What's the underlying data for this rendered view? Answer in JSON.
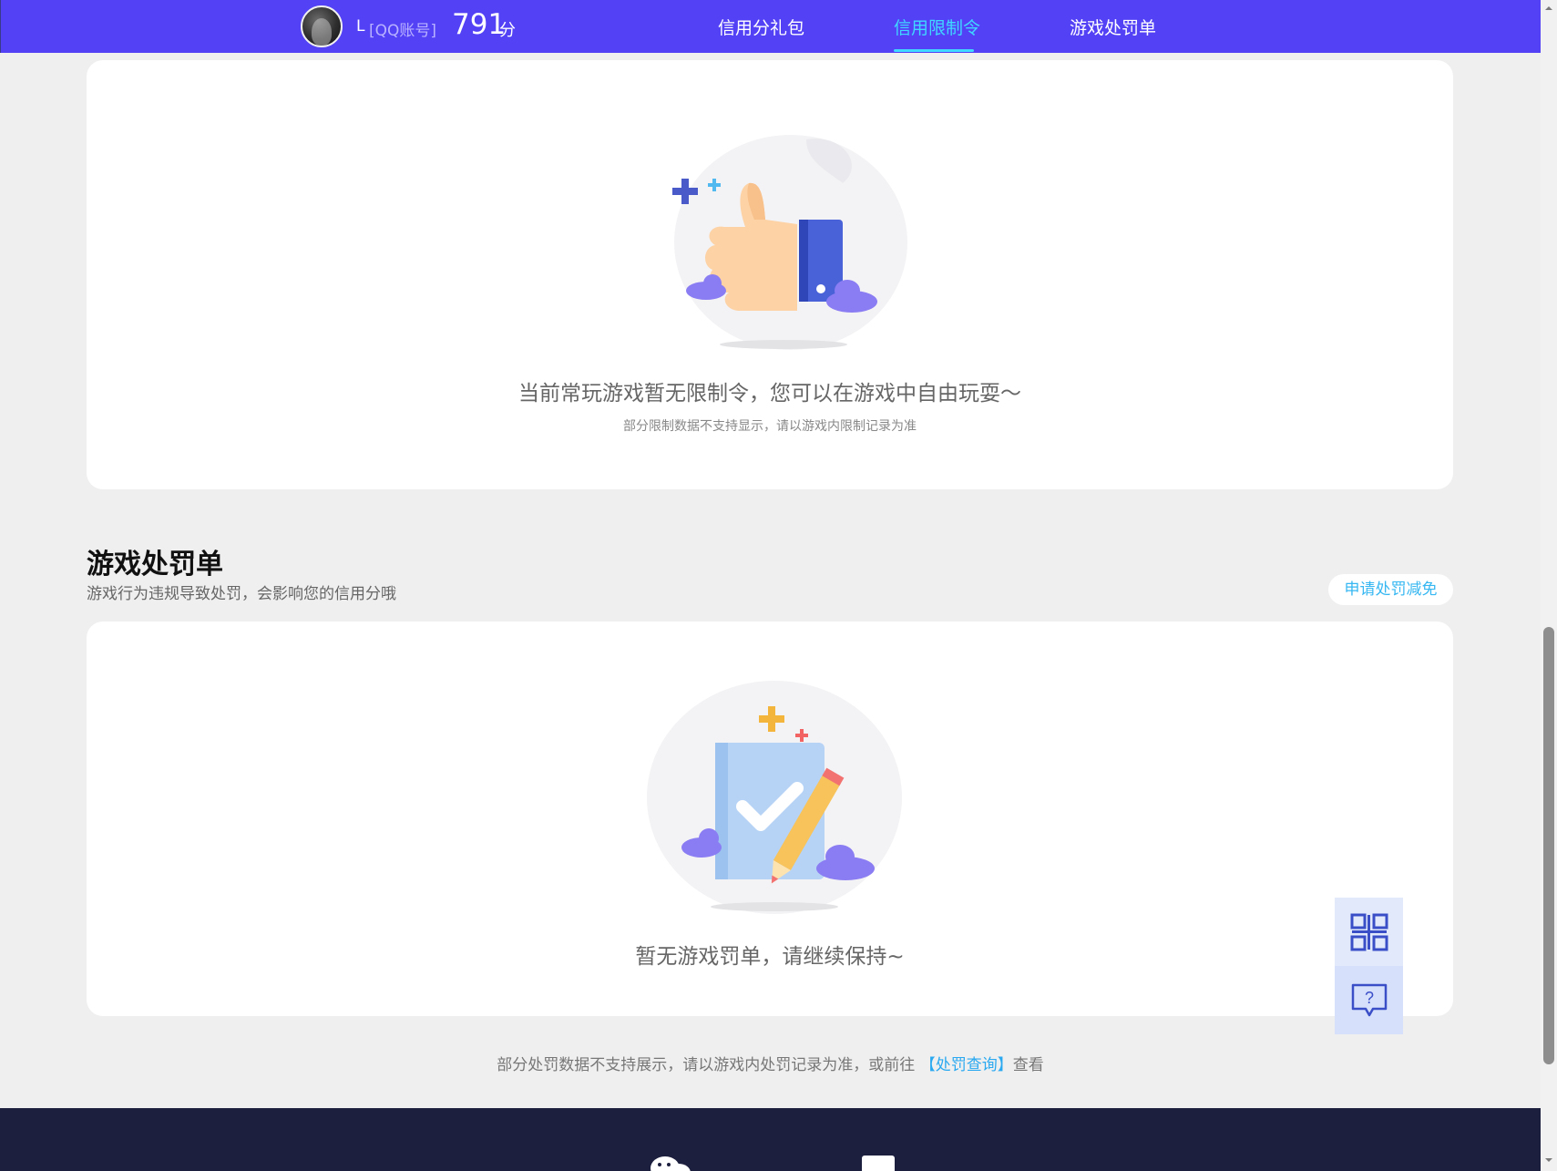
{
  "header": {
    "user_name": "L",
    "account_type": "[QQ账号]",
    "score": "791",
    "score_unit": "分",
    "tabs": [
      {
        "label": "信用分礼包"
      },
      {
        "label": "信用限制令"
      },
      {
        "label": "游戏处罚单"
      }
    ],
    "active_tab": "信用限制令"
  },
  "restriction_card": {
    "empty_title": "当前常玩游戏暂无限制令，您可以在游戏中自由玩耍～",
    "empty_note": "部分限制数据不支持显示，请以游戏内限制记录为准"
  },
  "penalty_section": {
    "title": "游戏处罚单",
    "description": "游戏行为违规导致处罚，会影响您的信用分哦",
    "appeal_button": "申请处罚减免",
    "empty_title": "暂无游戏罚单，请继续保持~"
  },
  "footer_note": {
    "prefix": "部分处罚数据不支持展示，请以游戏内处罚记录为准，或前往",
    "link": "【处罚查询】",
    "suffix": "查看"
  },
  "side_tools": {
    "qr_icon": "qrcode-icon",
    "help_icon": "help-chat-icon"
  },
  "colors": {
    "nav_bg": "#5341f6",
    "accent": "#3fd8ff",
    "link": "#2aa9f0",
    "footer_bg": "#1d1f3f"
  }
}
